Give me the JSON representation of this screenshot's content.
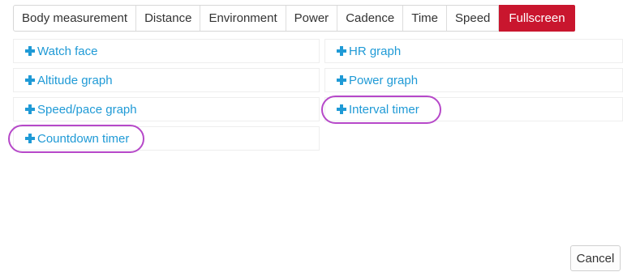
{
  "tabs": [
    {
      "label": "Body measurement"
    },
    {
      "label": "Distance"
    },
    {
      "label": "Environment"
    },
    {
      "label": "Power"
    },
    {
      "label": "Cadence"
    },
    {
      "label": "Time"
    },
    {
      "label": "Speed"
    },
    {
      "label": "Fullscreen",
      "active": true
    }
  ],
  "widgets": {
    "watch_face": "Watch face",
    "hr_graph": "HR graph",
    "altitude_graph": "Altitude graph",
    "power_graph": "Power graph",
    "speed_pace_graph": "Speed/pace graph",
    "interval_timer": "Interval timer",
    "countdown_timer": "Countdown timer"
  },
  "icons": {
    "add": "plus-icon"
  },
  "colors": {
    "accent_blue": "#1f9ad6",
    "active_tab_red": "#c9162e",
    "highlight_purple": "#b648c9"
  },
  "highlighted": [
    "Interval timer",
    "Countdown timer"
  ],
  "buttons": {
    "cancel": "Cancel"
  }
}
